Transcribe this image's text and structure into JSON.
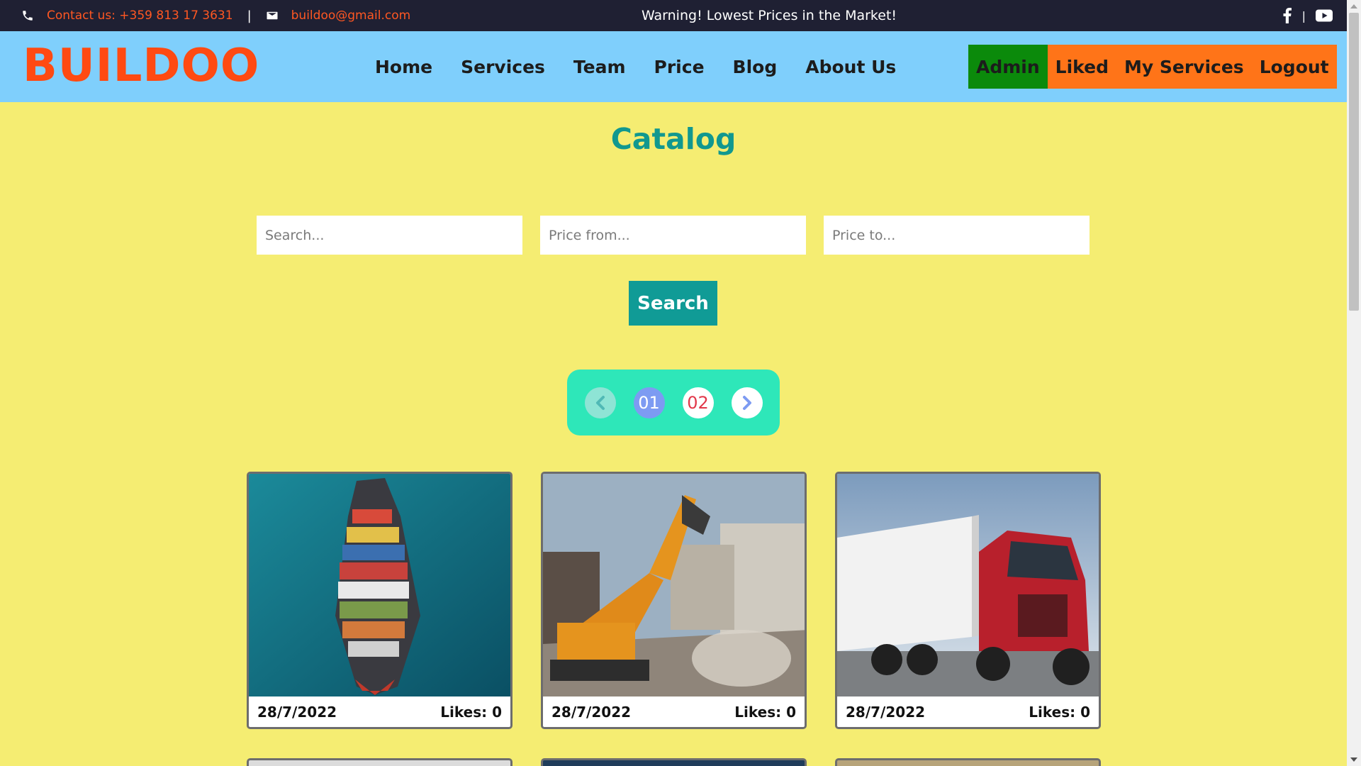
{
  "topbar": {
    "contact_phone": "Contact us: +359 813 17 3631",
    "separator": "|",
    "contact_email": "buildoo@gmail.com",
    "warning": "Warning! Lowest Prices in the Market!",
    "social_separator": "|",
    "icons": [
      "phone-icon",
      "mail-icon",
      "facebook-icon",
      "youtube-icon"
    ]
  },
  "header": {
    "logo": "BUILDOO",
    "nav": [
      "Home",
      "Services",
      "Team",
      "Price",
      "Blog",
      "About Us"
    ],
    "user_links": [
      "Admin",
      "Liked",
      "My Services",
      "Logout"
    ]
  },
  "catalog": {
    "title": "Catalog",
    "search_placeholder": "Search...",
    "price_from_placeholder": "Price from...",
    "price_to_placeholder": "Price to...",
    "search_button": "Search"
  },
  "pagination": {
    "pages": [
      "01",
      "02"
    ],
    "current": "01"
  },
  "cards": [
    {
      "image": "container-ship-photo",
      "date": "28/7/2022",
      "likes": "Likes: 0"
    },
    {
      "image": "excavator-demolition-photo",
      "date": "28/7/2022",
      "likes": "Likes: 0"
    },
    {
      "image": "red-semi-truck-photo",
      "date": "28/7/2022",
      "likes": "Likes: 0"
    }
  ],
  "colors": {
    "topbar_bg": "#1f2033",
    "header_bg": "#7fcffc",
    "page_bg": "#f5ed72",
    "logo": "#ff4a12",
    "accent_teal": "#11988f",
    "admin_bg": "#0b8a0b",
    "user_link_bg": "#ff7418",
    "pager_bg": "#2ee7b9"
  }
}
